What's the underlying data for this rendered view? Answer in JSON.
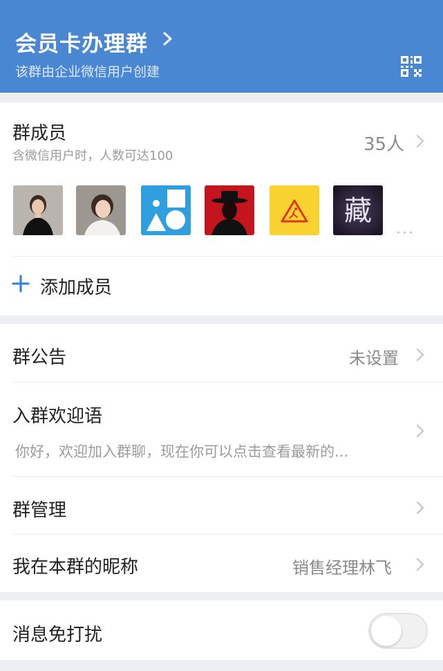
{
  "header": {
    "title": "会员卡办理群",
    "subtitle": "该群由企业微信用户创建",
    "qr_icon": "qrcode-icon",
    "chevron_icon": "chevron-right-icon",
    "background_color": "#4a87d3"
  },
  "members": {
    "label": "群成员",
    "hint": "含微信用户时，人数可达100",
    "count": "35人",
    "avatars": [
      {
        "name": "avatar-woman-black-dress"
      },
      {
        "name": "avatar-woman-short-hair"
      },
      {
        "name": "avatar-blue-shapes"
      },
      {
        "name": "avatar-red-hat-silhouette"
      },
      {
        "name": "avatar-yellow-warning-sign"
      },
      {
        "name": "avatar-calligraphy"
      }
    ],
    "avatar_calligraphy_char": "藏",
    "more_indicator": "···",
    "add_icon": "plus-icon",
    "add_label": "添加成员"
  },
  "settings": {
    "announcement_label": "群公告",
    "announcement_value": "未设置",
    "welcome_label": "入群欢迎语",
    "welcome_text": "你好，欢迎加入群聊，现在你可以点击查看最新的...",
    "manage_label": "群管理",
    "nickname_label": "我在本群的昵称",
    "nickname_value": "销售经理林飞"
  },
  "mute": {
    "label": "消息免打扰",
    "enabled": false
  }
}
